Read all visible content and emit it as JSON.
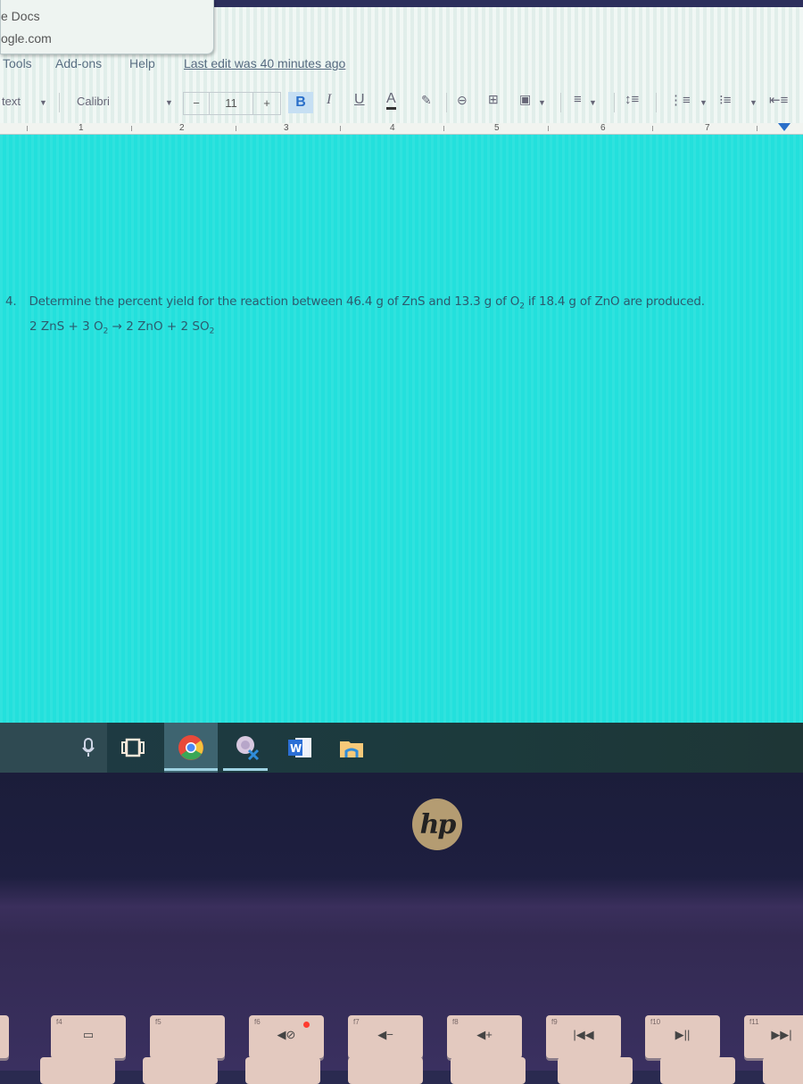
{
  "tooltip": {
    "line1": "e Docs",
    "line2": "ogle.com"
  },
  "menubar": {
    "items": [
      "Tools",
      "Add-ons",
      "Help"
    ],
    "last_edit": "Last edit was 40 minutes ago"
  },
  "toolbar": {
    "style_select": "text",
    "font_select": "Calibri",
    "font_size": "11",
    "decrease": "−",
    "increase": "+",
    "bold": "B",
    "italic": "I",
    "underline": "U",
    "text_color": "A"
  },
  "ruler": {
    "labels": [
      "1",
      "2",
      "3",
      "4",
      "5",
      "6",
      "7"
    ]
  },
  "document": {
    "question_number": "4.",
    "question_text_1": "Determine the percent yield for the reaction between 46.4 g of ZnS and 13.3 g of O",
    "question_sub": "2",
    "question_text_2": " if 18.4 g of ZnO are produced.",
    "equation": {
      "part1": "2 ZnS  +  3 O",
      "sub1": "2",
      "arrow": " → ",
      "part2": "2 ZnO  + 2 SO",
      "sub2": "2"
    }
  },
  "taskbar": {
    "items": [
      "microphone",
      "task-view",
      "chrome",
      "snipping-tool",
      "word",
      "file-explorer"
    ]
  },
  "laptop": {
    "logo": "hp"
  },
  "keyboard": {
    "keys": [
      {
        "fn": "f4",
        "glyph": "▭"
      },
      {
        "fn": "f5",
        "glyph": ""
      },
      {
        "fn": "f6",
        "glyph": "◀⊘"
      },
      {
        "fn": "f7",
        "glyph": "◀−"
      },
      {
        "fn": "f8",
        "glyph": "◀+"
      },
      {
        "fn": "f9",
        "glyph": "|◀◀"
      },
      {
        "fn": "f10",
        "glyph": "▶||"
      },
      {
        "fn": "f11",
        "glyph": "▶▶|"
      }
    ]
  },
  "colors": {
    "doc_background": "#23e0dc",
    "text": "#2c5b6e",
    "bold_active": "#2a6fc9",
    "mute_led": "#ff3b2f"
  }
}
